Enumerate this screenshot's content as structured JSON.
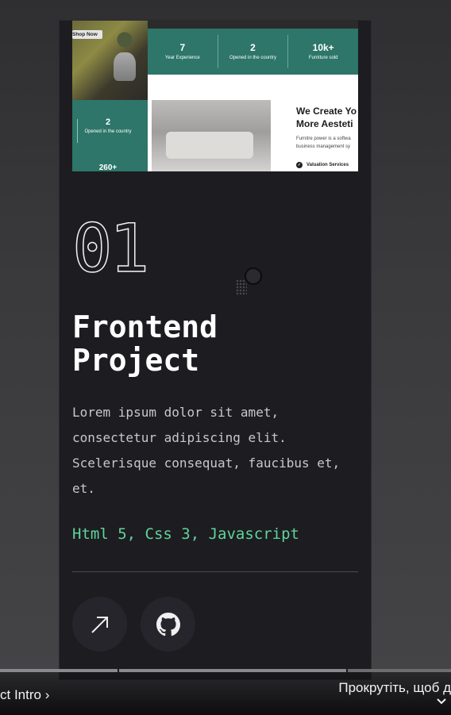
{
  "thumbnail": {
    "shop_button": "Shop Now",
    "stats": [
      {
        "number": "7",
        "label": "Year Experience"
      },
      {
        "number": "2",
        "label": "Opened in the country"
      },
      {
        "number": "10k+",
        "label": "Furniture sold"
      }
    ],
    "side_stat": {
      "number": "2",
      "label": "Opened in the country",
      "number2": "260+"
    },
    "headline_1": "We Create Yo",
    "headline_2": "More Aesteti",
    "para_1": "Furnitre power is a softwa",
    "para_2": "business management sy",
    "service": "Valuation Services"
  },
  "project": {
    "number": "01",
    "title": "Frontend\nProject",
    "description": "Lorem ipsum dolor sit amet, consectetur adipiscing elit. Scelerisque consequat, faucibus et, et.",
    "tech": "Html 5,  Css 3,  Javascript"
  },
  "icons": {
    "live": "arrow-up-right-icon",
    "github": "github-icon"
  },
  "video_overlay": {
    "chapter_title": "ct Intro",
    "scroll_hint": "Прокрутіть, щоб д"
  },
  "colors": {
    "card_bg": "#1d1c21",
    "accent": "#5fd49a",
    "teal": "#2d7669"
  }
}
